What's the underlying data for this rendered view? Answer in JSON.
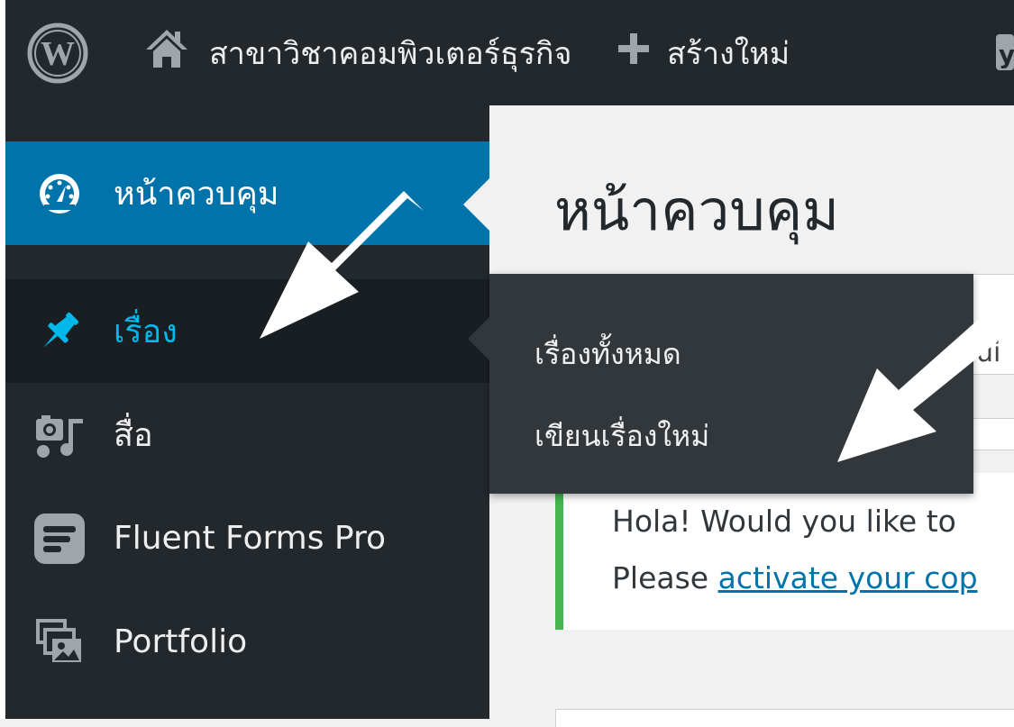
{
  "admin_bar": {
    "wp_logo_icon": "wordpress-logo-icon",
    "home_icon": "home-icon",
    "site_name": "สาขาวิชาคอมพิวเตอร์ธุรกิจ",
    "plus_icon": "plus-icon",
    "new_label": "สร้างใหม่",
    "yoast_icon": "yoast-seo-icon"
  },
  "sidebar": {
    "items": [
      {
        "label": "หน้าควบคุม",
        "icon": "dashboard-icon",
        "state": "current"
      },
      {
        "label": "เรื่อง",
        "icon": "pushpin-icon",
        "state": "hover"
      },
      {
        "label": "สื่อ",
        "icon": "media-icon"
      },
      {
        "label": "Fluent Forms Pro",
        "icon": "fluent-forms-icon"
      },
      {
        "label": "Portfolio",
        "icon": "portfolio-icon"
      }
    ]
  },
  "flyout": {
    "items": [
      {
        "label": "เรื่องทั้งหมด"
      },
      {
        "label": "เขียนเรื่องใหม่"
      }
    ]
  },
  "main": {
    "title": "หน้าควบคุม",
    "welcome_peek": "ui",
    "notice": {
      "line1": "Hola! Would you like to",
      "line2_prefix": "Please ",
      "line2_link": "activate your cop"
    }
  },
  "colors": {
    "admin_bar_bg": "#23282d",
    "sidebar_bg": "#23282d",
    "current_item_bg": "#0073aa",
    "hover_item_bg": "#191e23",
    "hover_text": "#00b9eb",
    "flyout_bg": "#32373c",
    "notice_border": "#46b450",
    "link": "#0073aa"
  }
}
